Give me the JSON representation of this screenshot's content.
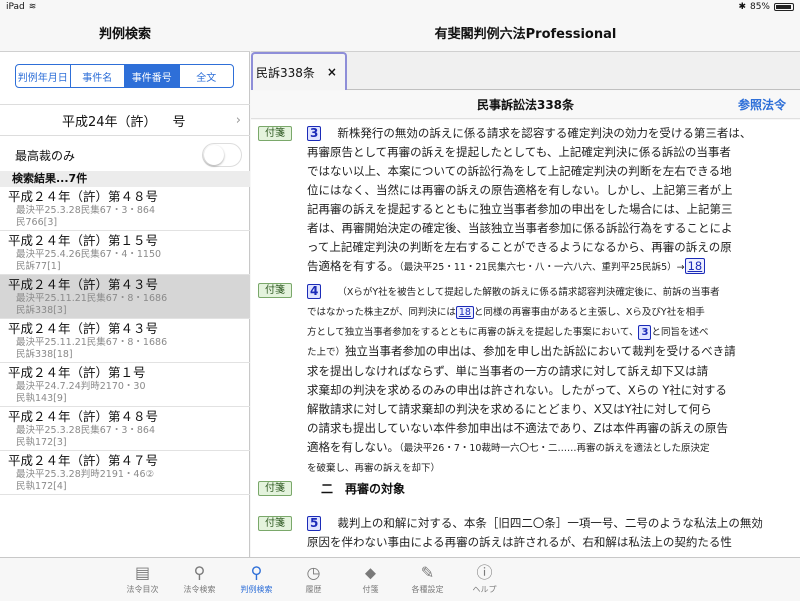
{
  "status": {
    "device": "iPad",
    "battery": "85%"
  },
  "left": {
    "title": "判例検索",
    "segments": [
      "判例年月日",
      "事件名",
      "事件番号",
      "全文"
    ],
    "era": "平成24年（許）",
    "number_suffix": "号",
    "toggle_label": "最高裁のみ",
    "results_header": "検索結果...7件",
    "results": [
      {
        "title": "平成２４年（許）第４８号",
        "line1": "最決平25.3.28民集67・3・864",
        "line2": "民766[3]"
      },
      {
        "title": "平成２４年（許）第１５号",
        "line1": "最決平25.4.26民集67・4・1150",
        "line2": "民訴77[1]"
      },
      {
        "title": "平成２４年（許）第４３号",
        "line1": "最決平25.11.21民集67・8・1686",
        "line2": "民訴338[3]"
      },
      {
        "title": "平成２４年（許）第４３号",
        "line1": "最決平25.11.21民集67・8・1686",
        "line2": "民訴338[18]"
      },
      {
        "title": "平成２４年（許）第１号",
        "line1": "最決平24.7.24判時2170・30",
        "line2": "民執143[9]"
      },
      {
        "title": "平成２４年（許）第４８号",
        "line1": "最決平25.3.28民集67・3・864",
        "line2": "民執172[3]"
      },
      {
        "title": "平成２４年（許）第４７号",
        "line1": "最決平25.3.28判時2191・46②",
        "line2": "民執172[4]"
      }
    ]
  },
  "right": {
    "app_title": "有斐閣判例六法Professional",
    "tab_label": "民訴338条",
    "tab_close": "×",
    "law_title": "民事訴訟法338条",
    "reference_button": "参照法令",
    "tag_label": "付箋",
    "p3": {
      "num": "3",
      "lines": [
        "新株発行の無効の訴えに係る請求を認容する確定判決の効力を受ける第三者は、",
        "再審原告として再審の訴えを提起したとしても、上記確定判決に係る訴訟の当事者",
        "ではない以上、本案についての訴訟行為をして上記確定判決の判断を左右できる地",
        "位にはなく、当然には再審の訴えの原告適格を有しない。しかし、上記第三者が上",
        "記再審の訴えを提起するとともに独立当事者参加の申出をした場合には、上記第三",
        "者は、再審開始決定の確定後、当該独立当事者参加に係る訴訟行為をすることによ",
        "って上記確定判決の判断を左右することができるようになるから、再審の訴えの原"
      ],
      "last_line": "告適格を有する。",
      "citation": "（最決平25・11・21民集六七・八・一六八六、重判平25民訴5）→",
      "link": "18"
    },
    "p4": {
      "num": "4",
      "small_lines": [
        "（XらがY社を被告として提起した解散の訴えに係る請求認容判決確定後に、前訴の当事者",
        "ではなかった株主Zが、同判決には",
        "と同様の再審事由があると主張し、Xら及びY社を相手",
        "方として独立当事者参加をするとともに再審の訴えを提起した事案において、",
        "と同旨を述べ",
        "た上で）"
      ],
      "link": "18",
      "num3": "3",
      "lines": [
        "独立当事者参加の申出は、参加を申し出た訴訟において裁判を受けるべき請",
        "求を提出しなければならず、単に当事者の一方の請求に対して訴え却下又は請",
        "求棄却の判決を求めるのみの申出は許されない。したがって、Xらの Y社に対する",
        "解散請求に対して請求棄却の判決を求めるにとどまり、X又はY社に対して何ら",
        "の請求も提出していない本件参加申出は不適法であり、Zは本件再審の訴えの原告",
        "適格を有しない。"
      ],
      "citation": "（最決平26・7・10裁時一六〇七・二……再審の訴えを適法とした原決定",
      "citation2": "を破棄し、再審の訴えを却下）"
    },
    "heading": "二　再審の対象",
    "p5": {
      "num": "5",
      "lines": [
        "裁判上の和解に対する、本条［旧四二〇条］一項一号、二号のような私法上の無効",
        "原因を伴わない事由による再審の訴えは許されるが、右和解は私法上の契約たる性"
      ]
    }
  },
  "toolbar": [
    {
      "icon": "book-icon",
      "glyph": "▤",
      "label": "法令目次"
    },
    {
      "icon": "search-icon",
      "glyph": "⚲",
      "label": "法令検索"
    },
    {
      "icon": "search-icon",
      "glyph": "⚲",
      "label": "判例検索",
      "active": true
    },
    {
      "icon": "clock-icon",
      "glyph": "◷",
      "label": "履歴"
    },
    {
      "icon": "tag-icon",
      "glyph": "⬥",
      "label": "付箋"
    },
    {
      "icon": "wrench-icon",
      "glyph": "✎",
      "label": "各種設定"
    },
    {
      "icon": "info-icon",
      "glyph": "ⓘ",
      "label": "ヘルプ"
    }
  ],
  "colors": {
    "accent": "#2e6fd8",
    "tag_bg": "#e4f3dd",
    "link": "#1b2bb8"
  }
}
